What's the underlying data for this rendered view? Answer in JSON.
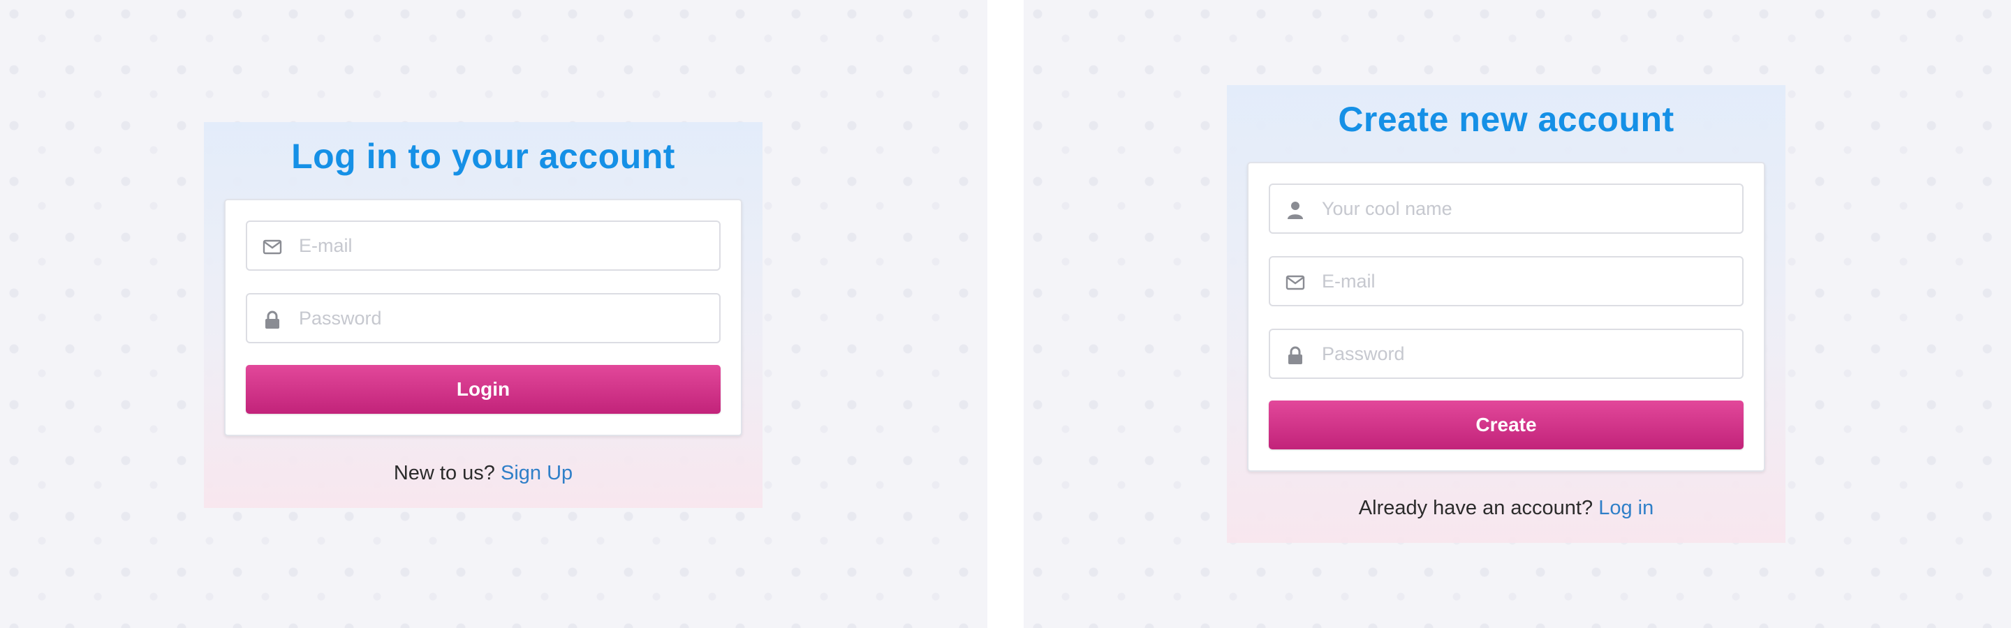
{
  "login": {
    "title": "Log in to your account",
    "email_placeholder": "E-mail",
    "password_placeholder": "Password",
    "button_label": "Login",
    "footer_text": "New to us? ",
    "footer_link": "Sign Up"
  },
  "signup": {
    "title": "Create new account",
    "name_placeholder": "Your cool name",
    "email_placeholder": "E-mail",
    "password_placeholder": "Password",
    "button_label": "Create",
    "footer_text": "Already have an account? ",
    "footer_link": "Log in"
  },
  "colors": {
    "title_blue": "#1590e6",
    "button_pink": "#d6338a",
    "link_blue": "#2f7fc8",
    "background": "#f4f4f8"
  },
  "icons": {
    "email": "envelope-icon",
    "password": "lock-icon",
    "name": "user-icon"
  }
}
